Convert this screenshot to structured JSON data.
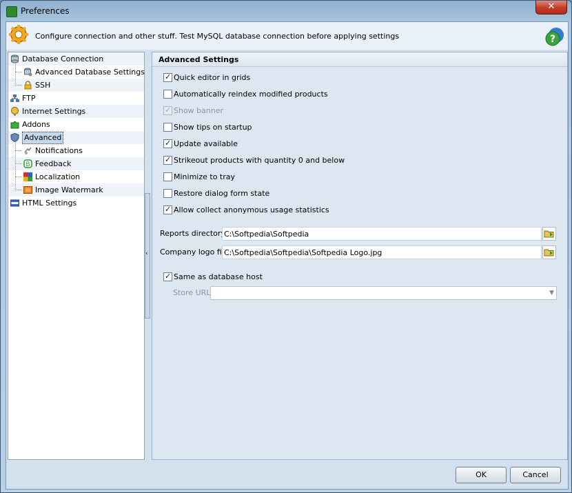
{
  "window": {
    "title": "Preferences",
    "close_glyph": "✕"
  },
  "header": {
    "text": "Configure connection and other stuff. Test MySQL database connection before applying settings"
  },
  "tree": {
    "items": [
      {
        "label": "Database Connection",
        "icon": "database-icon",
        "level": 0
      },
      {
        "label": "Advanced Database Settings",
        "icon": "database-settings-icon",
        "level": 1
      },
      {
        "label": "SSH",
        "icon": "lock-icon",
        "level": 1
      },
      {
        "label": "FTP",
        "icon": "ftp-network-icon",
        "level": 0
      },
      {
        "label": "Internet Settings",
        "icon": "globe-icon",
        "level": 0
      },
      {
        "label": "Addons",
        "icon": "puzzle-icon",
        "level": 0
      },
      {
        "label": "Advanced",
        "icon": "shield-icon",
        "level": 0,
        "selected": true
      },
      {
        "label": "Notifications",
        "icon": "notification-icon",
        "level": 1
      },
      {
        "label": "Feedback",
        "icon": "feedback-icon",
        "level": 1
      },
      {
        "label": "Localization",
        "icon": "localization-icon",
        "level": 1
      },
      {
        "label": "Image Watermark",
        "icon": "watermark-icon",
        "level": 1
      },
      {
        "label": "HTML Settings",
        "icon": "html-icon",
        "level": 0
      }
    ]
  },
  "panel": {
    "title": "Advanced Settings",
    "checkboxes": [
      {
        "label": "Quick editor in grids",
        "checked": true,
        "enabled": true
      },
      {
        "label": "Automatically reindex modified products",
        "checked": false,
        "enabled": true
      },
      {
        "label": "Show banner",
        "checked": true,
        "enabled": false
      },
      {
        "label": "Show tips on startup",
        "checked": false,
        "enabled": true
      },
      {
        "label": "Update available",
        "checked": true,
        "enabled": true
      },
      {
        "label": "Strikeout products with quantity 0 and below",
        "checked": true,
        "enabled": true
      },
      {
        "label": "Minimize to tray",
        "checked": false,
        "enabled": true
      },
      {
        "label": "Restore dialog form state",
        "checked": false,
        "enabled": true
      },
      {
        "label": "Allow collect anonymous usage statistics",
        "checked": true,
        "enabled": true
      }
    ],
    "reports_directory": {
      "label": "Reports directory",
      "value": "C:\\Softpedia\\Softpedia"
    },
    "company_logo": {
      "label": "Company logo file",
      "value": "C:\\Softpedia\\Softpedia\\Softpedia Logo.jpg"
    },
    "same_as_db_host": {
      "label": "Same as database host",
      "checked": true
    },
    "store_url": {
      "label": "Store URL",
      "value": ""
    }
  },
  "buttons": {
    "ok": "OK",
    "cancel": "Cancel"
  },
  "colors": {
    "accent": "#c5d7ea",
    "panel_bg": "#dde7f2",
    "header_bg": "#e9f0f8"
  }
}
